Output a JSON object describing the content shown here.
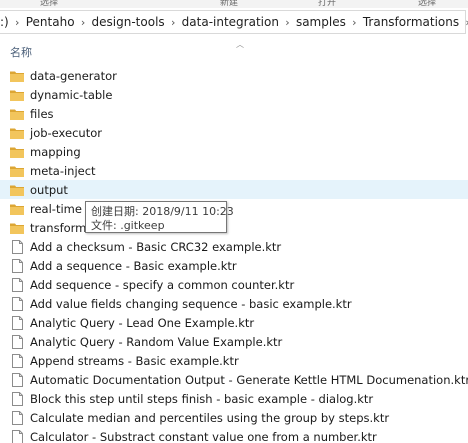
{
  "ribbon": {
    "labels": [
      "选择",
      "新建",
      "打开",
      "选择"
    ]
  },
  "address": {
    "lead": ":)",
    "crumbs": [
      "Pentaho",
      "design-tools",
      "data-integration",
      "samples",
      "Transformations"
    ]
  },
  "columns": {
    "name": "名称"
  },
  "items": [
    {
      "label": "data-generator",
      "type": "folder"
    },
    {
      "label": "dynamic-table",
      "type": "folder"
    },
    {
      "label": "files",
      "type": "folder"
    },
    {
      "label": "job-executor",
      "type": "folder"
    },
    {
      "label": "mapping",
      "type": "folder"
    },
    {
      "label": "meta-inject",
      "type": "folder"
    },
    {
      "label": "output",
      "type": "folder"
    },
    {
      "label": "real-time st",
      "type": "folder"
    },
    {
      "label": "transformat",
      "type": "folder"
    },
    {
      "label": "Add a checksum - Basic CRC32 example.ktr",
      "type": "file"
    },
    {
      "label": "Add a sequence - Basic example.ktr",
      "type": "file"
    },
    {
      "label": "Add sequence - specify a common counter.ktr",
      "type": "file"
    },
    {
      "label": "Add value fields changing sequence - basic example.ktr",
      "type": "file"
    },
    {
      "label": "Analytic Query - Lead One Example.ktr",
      "type": "file"
    },
    {
      "label": "Analytic Query - Random Value Example.ktr",
      "type": "file"
    },
    {
      "label": "Append streams - Basic example.ktr",
      "type": "file"
    },
    {
      "label": "Automatic Documentation Output - Generate Kettle HTML Documenation.ktr",
      "type": "file"
    },
    {
      "label": "Block this step until steps finish - basic example - dialog.ktr",
      "type": "file"
    },
    {
      "label": "Calculate median and percentiles using the group by steps.ktr",
      "type": "file"
    },
    {
      "label": "Calculator - Substract constant value one from a number.ktr",
      "type": "file"
    }
  ],
  "tooltip": {
    "created": "创建日期: 2018/9/11 10:23",
    "files": "文件: .gitkeep"
  },
  "colors": {
    "folder": "#f2c55c",
    "folder_dark": "#dca634",
    "hover": "#e5f3fb"
  }
}
